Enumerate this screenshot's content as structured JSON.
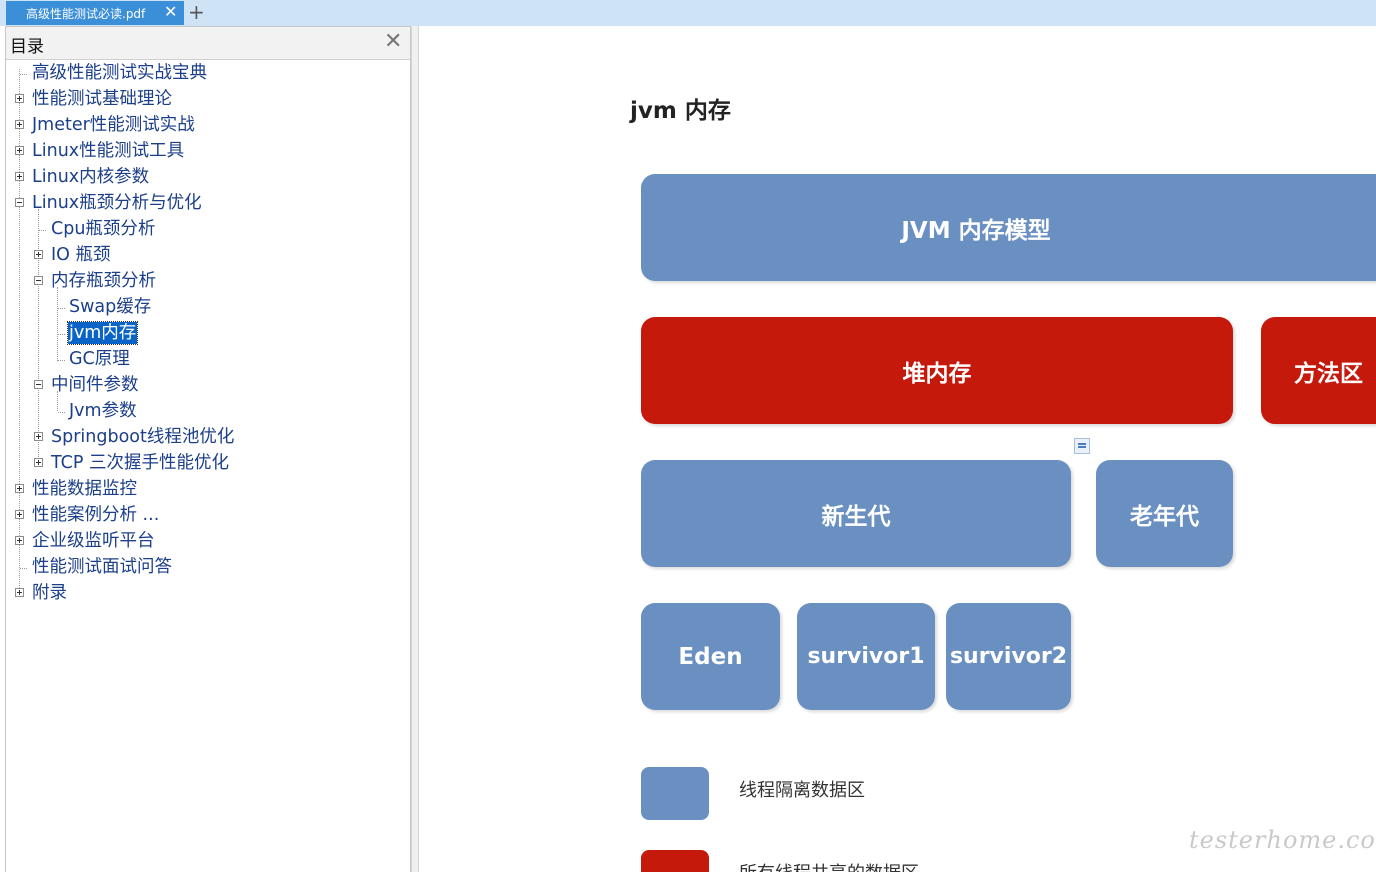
{
  "tab": {
    "title": "高级性能测试必读.pdf",
    "close_symbol": "✕",
    "new_symbol": "+"
  },
  "sidebar": {
    "title": "目录",
    "close_symbol": "✕",
    "items": [
      {
        "label": "高级性能测试实战宝典"
      },
      {
        "label": "性能测试基础理论"
      },
      {
        "label": "Jmeter性能测试实战"
      },
      {
        "label": "Linux性能测试工具"
      },
      {
        "label": "Linux内核参数"
      },
      {
        "label": "Linux瓶颈分析与优化"
      },
      {
        "label": "Cpu瓶颈分析"
      },
      {
        "label": "IO 瓶颈"
      },
      {
        "label": "内存瓶颈分析"
      },
      {
        "label": "Swap缓存"
      },
      {
        "label": "jvm内存",
        "selected": true
      },
      {
        "label": "GC原理"
      },
      {
        "label": "中间件参数"
      },
      {
        "label": "Jvm参数"
      },
      {
        "label": "Springboot线程池优化"
      },
      {
        "label": "TCP 三次握手性能优化"
      },
      {
        "label": "性能数据监控"
      },
      {
        "label": "性能案例分析 ..."
      },
      {
        "label": "企业级监听平台"
      },
      {
        "label": "性能测试面试问答"
      },
      {
        "label": "附录"
      }
    ]
  },
  "document": {
    "heading": "jvm 内存",
    "diagram": {
      "jvm_model": "JVM 内存模型",
      "heap": "堆内存",
      "method_area": "方法区",
      "young_gen": "新生代",
      "old_gen": "老年代",
      "eden": "Eden",
      "survivor1": "survivor1",
      "survivor2": "survivor2"
    },
    "legend": [
      {
        "text": "线程隔离数据区",
        "color": "#6a8fc1"
      },
      {
        "text": "所有线程共享的数据区",
        "color": "#c5190c"
      }
    ]
  },
  "watermark": "testerhome.com",
  "colors": {
    "tab_active": "#3b8fd9",
    "tabbar": "#cfe3f7",
    "box_blue": "#6a8fc1",
    "box_red": "#c5190c",
    "tree_text": "#1c3f8a",
    "selection": "#0a64c8"
  }
}
